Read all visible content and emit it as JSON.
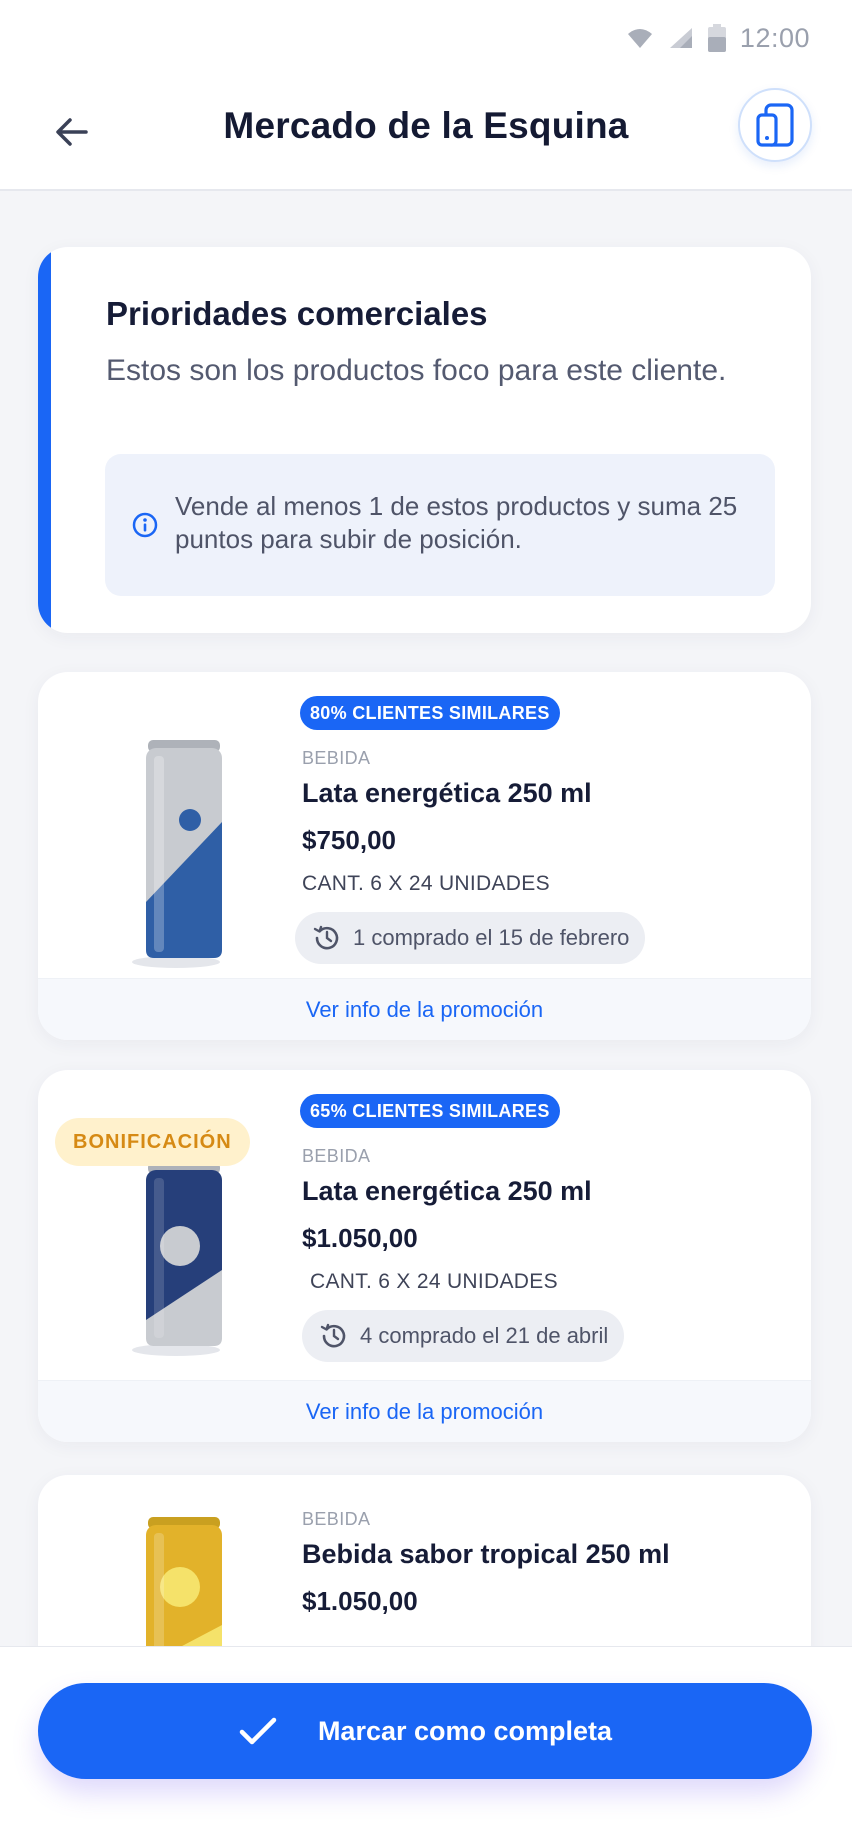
{
  "status_bar": {
    "time": "12:00"
  },
  "header": {
    "title": "Mercado de la Esquina"
  },
  "priorities": {
    "title": "Prioridades comerciales",
    "subtitle": "Estos son los productos foco para este cliente.",
    "info": "Vende al menos 1 de estos productos y suma 25 puntos para subir de posición."
  },
  "products": [
    {
      "badge": "80% CLIENTES SIMILARES",
      "category": "BEBIDA",
      "name": "Lata energética 250 ml",
      "price": "$750,00",
      "quantity": "CANT. 6 X 24 UNIDADES",
      "history": "1 comprado el 15 de febrero",
      "promo_link": "Ver info de la promoción",
      "can_colors": {
        "body": "#c8cbd0",
        "accent": "#2f5fa6"
      }
    },
    {
      "badge": "65% CLIENTES SIMILARES",
      "bonus_badge": "BONIFICACIÓN",
      "category": "BEBIDA",
      "name": "Lata energética 250 ml",
      "price": "$1.050,00",
      "quantity": "CANT. 6 X 24 UNIDADES",
      "history": "4 comprado el 21 de abril",
      "promo_link": "Ver info de la promoción",
      "can_colors": {
        "body": "#263f7a",
        "accent": "#c8cbd0"
      }
    },
    {
      "category": "BEBIDA",
      "name": "Bebida sabor tropical 250 ml",
      "price": "$1.050,00",
      "can_colors": {
        "body": "#e2b22a",
        "accent": "#f5e26a"
      }
    }
  ],
  "footer": {
    "cta_label": "Marcar como completa"
  },
  "colors": {
    "accent": "#1a66f5",
    "bonus_bg": "#fff1cc",
    "bonus_text": "#d68a14"
  }
}
